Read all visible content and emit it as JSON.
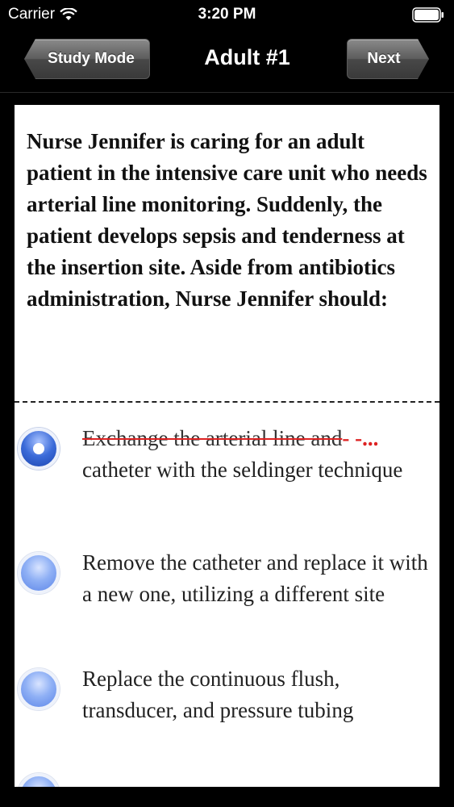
{
  "status_bar": {
    "carrier": "Carrier",
    "time": "3:20 PM"
  },
  "nav": {
    "back_label": "Study Mode",
    "title": "Adult #1",
    "next_label": "Next"
  },
  "question": {
    "text": "Nurse Jennifer is caring for an adult patient in the intensive care unit who needs arterial line monitoring. Suddenly, the patient develops sepsis and tenderness at the insertion site. Aside from antibiotics administration, Nurse Jennifer should:"
  },
  "options": [
    {
      "state": "selected-struck",
      "struck_text": "Exchange the arterial line and",
      "struck_trail": "- -...",
      "rest_text": "catheter with the seldinger technique"
    },
    {
      "state": "unselected",
      "text": "Remove the catheter and replace it with a new one, utilizing a different site"
    },
    {
      "state": "unselected",
      "text": "Replace the continuous flush, transducer, and pressure tubing"
    }
  ],
  "colors": {
    "background": "#000000",
    "card": "#ffffff",
    "strike": "#dd2222",
    "radio_blue": "#5d86e8"
  }
}
